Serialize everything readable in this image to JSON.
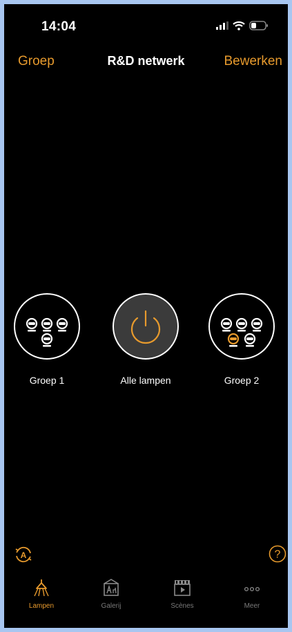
{
  "status": {
    "time": "14:04"
  },
  "nav": {
    "left": "Groep",
    "title": "R&D netwerk",
    "right": "Bewerken"
  },
  "groups": [
    {
      "label": "Groep 1"
    },
    {
      "label": "Alle lampen"
    },
    {
      "label": "Groep 2"
    }
  ],
  "tabs": [
    {
      "label": "Lampen",
      "icon": "lamp-icon",
      "active": true
    },
    {
      "label": "Galerij",
      "icon": "gallery-icon",
      "active": false
    },
    {
      "label": "Scènes",
      "icon": "scenes-icon",
      "active": false
    },
    {
      "label": "Meer",
      "icon": "more-icon",
      "active": false
    }
  ],
  "colors": {
    "accent": "#e79a2d",
    "background": "#000000",
    "frame": "#a8c6f0"
  }
}
